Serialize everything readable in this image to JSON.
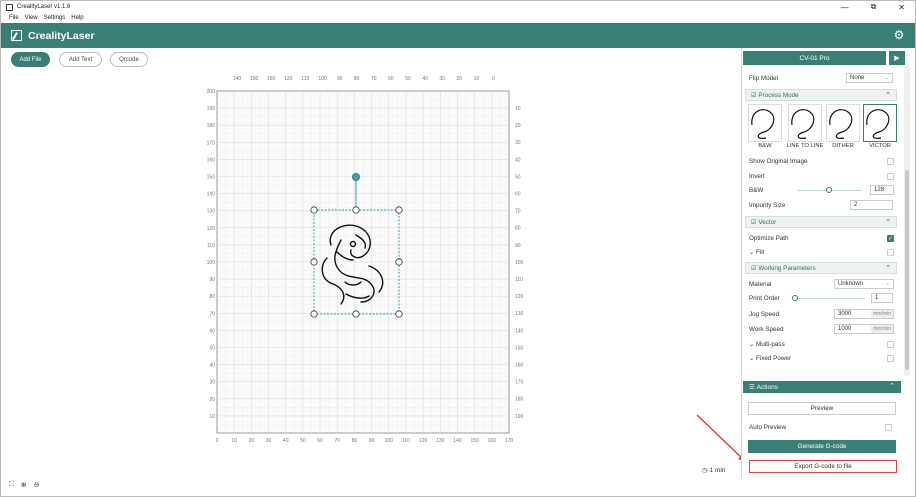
{
  "window": {
    "title": "CrealityLaser v1.1.6",
    "controls": [
      "—",
      "⧉",
      "✕"
    ]
  },
  "menu": [
    "File",
    "View",
    "Settings",
    "Help"
  ],
  "header": {
    "brand": "CrealityLaser",
    "settings_icon": "gear-icon"
  },
  "toolbar": {
    "add_file": "Add File",
    "add_text": "Add Text",
    "qrcode": "Qrcode"
  },
  "canvas": {
    "x_ticks_bottom": [
      "0",
      "10",
      "20",
      "30",
      "40",
      "50",
      "60",
      "70",
      "80",
      "90",
      "100",
      "110",
      "120",
      "130",
      "140",
      "150",
      "160",
      "170"
    ],
    "x_ticks_top": [
      "140",
      "150",
      "160",
      "120",
      "110",
      "100",
      "90",
      "80",
      "70",
      "60",
      "50",
      "40",
      "30",
      "20",
      "10",
      "0"
    ],
    "y_ticks_left": [
      "200",
      "190",
      "180",
      "170",
      "160",
      "150",
      "140",
      "130",
      "120",
      "110",
      "100",
      "90",
      "80",
      "70",
      "60",
      "50",
      "40",
      "30",
      "20",
      "10"
    ],
    "y_ticks_right": [
      "10",
      "20",
      "30",
      "40",
      "50",
      "60",
      "70",
      "80",
      "90",
      "100",
      "110",
      "120",
      "130",
      "140",
      "150",
      "160",
      "170",
      "180",
      "190"
    ],
    "estimated_time": "1 min"
  },
  "panel": {
    "machine": "CV-01 Pro",
    "flip_model": {
      "label": "Flip Model",
      "value": "None"
    },
    "process_mode": {
      "title": "Process Mode",
      "modes": [
        "B&W",
        "LINE TO LINE",
        "DITHER",
        "VICTOR"
      ],
      "selected": "VICTOR"
    },
    "show_original_image": "Show Original Image",
    "invert": "Invert",
    "bw": {
      "label": "B&W",
      "value": "128"
    },
    "impurity_size": {
      "label": "Impurity Size",
      "value": "2"
    },
    "vector": {
      "title": "Vector",
      "optimize_path": "Optimize Path",
      "optimize_checked": true,
      "fill": "Fill"
    },
    "working": {
      "title": "Working Parameters",
      "material_label": "Material",
      "material_value": "Unknown",
      "print_order_label": "Print Order",
      "print_order_value": "1",
      "jog_speed_label": "Jog Speed",
      "jog_speed_value": "3000",
      "work_speed_label": "Work Speed",
      "work_speed_value": "1000",
      "speed_unit": "mm/min",
      "multi_pass": "Multi-pass",
      "fixed_power": "Fixed Power"
    },
    "actions": {
      "title": "Actions",
      "preview": "Preview",
      "auto_preview": "Auto Preview",
      "generate": "Generate G-code",
      "export": "Export G-code to file"
    }
  },
  "colors": {
    "accent": "#3a7f75",
    "highlight": "#e04040"
  }
}
